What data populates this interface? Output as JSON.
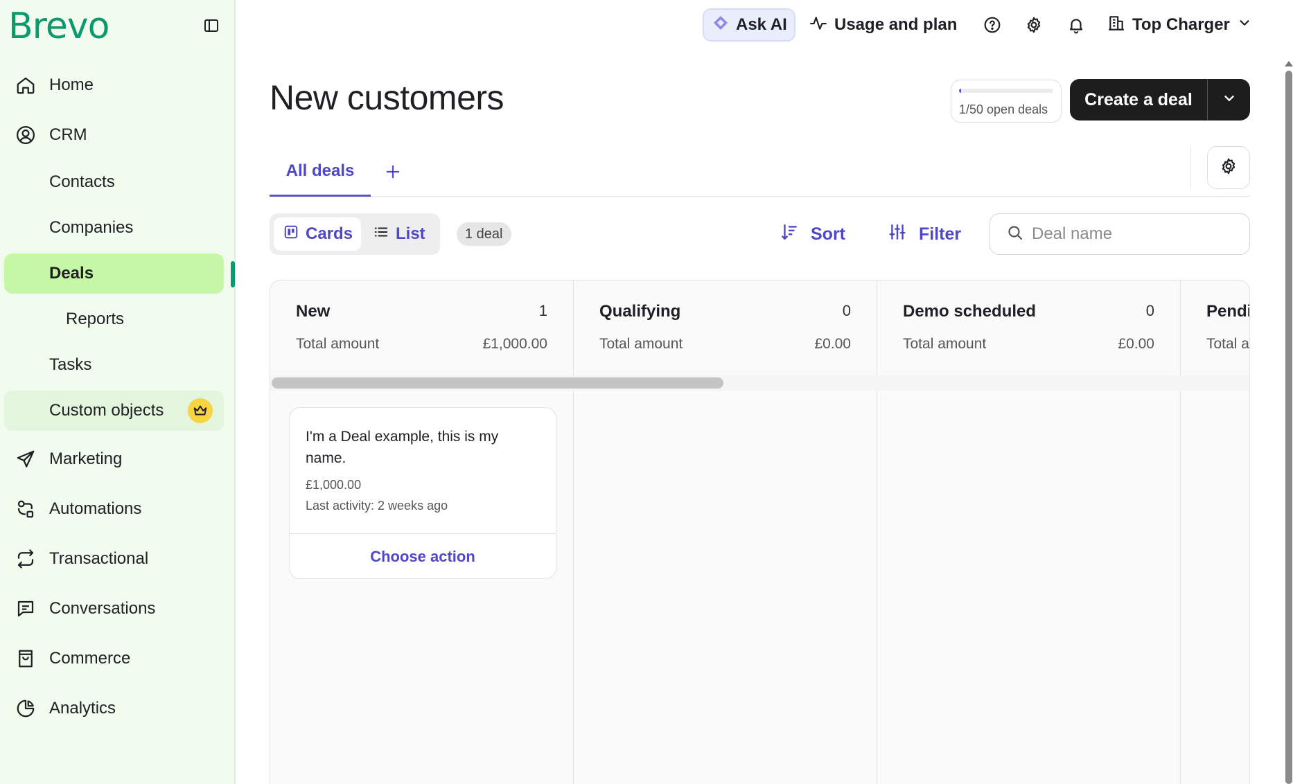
{
  "brand": {
    "logo_text": "Brevo",
    "accent": "#0b996e",
    "primary": "#5c54c8"
  },
  "sidebar": {
    "items": [
      {
        "label": "Home",
        "icon": "home-icon"
      },
      {
        "label": "CRM",
        "icon": "user-circle-icon"
      },
      {
        "label": "Contacts"
      },
      {
        "label": "Companies"
      },
      {
        "label": "Deals",
        "active": true
      },
      {
        "label": "Reports"
      },
      {
        "label": "Tasks"
      },
      {
        "label": "Custom objects",
        "badge_icon": "crown-icon"
      },
      {
        "label": "Marketing",
        "icon": "paper-plane-icon"
      },
      {
        "label": "Automations",
        "icon": "automation-icon"
      },
      {
        "label": "Transactional",
        "icon": "repeat-icon"
      },
      {
        "label": "Conversations",
        "icon": "chat-icon"
      },
      {
        "label": "Commerce",
        "icon": "shopping-bag-icon"
      },
      {
        "label": "Analytics",
        "icon": "pie-chart-icon"
      }
    ]
  },
  "topbar": {
    "ask_ai": "Ask AI",
    "usage": "Usage and plan",
    "organization": "Top Charger"
  },
  "header": {
    "title": "New customers",
    "quota_text": "1/50 open deals",
    "quota_fraction": 0.02,
    "create_label": "Create a deal"
  },
  "tabs": {
    "active": "All deals"
  },
  "toolbar": {
    "cards_label": "Cards",
    "list_label": "List",
    "deal_count": "1 deal",
    "sort_label": "Sort",
    "filter_label": "Filter",
    "search_placeholder": "Deal name"
  },
  "pipeline": {
    "stages": [
      {
        "name": "New",
        "count": "1",
        "total_label": "Total amount",
        "total": "£1,000.00"
      },
      {
        "name": "Qualifying",
        "count": "0",
        "total_label": "Total amount",
        "total": "£0.00"
      },
      {
        "name": "Demo scheduled",
        "count": "0",
        "total_label": "Total amount",
        "total": "£0.00"
      },
      {
        "name": "Pendi",
        "total_label": "Total a"
      }
    ],
    "deal": {
      "name": "I'm a Deal example, this is my name.",
      "amount": "£1,000.00",
      "last_activity": "Last activity: 2 weeks ago",
      "action": "Choose action"
    }
  }
}
